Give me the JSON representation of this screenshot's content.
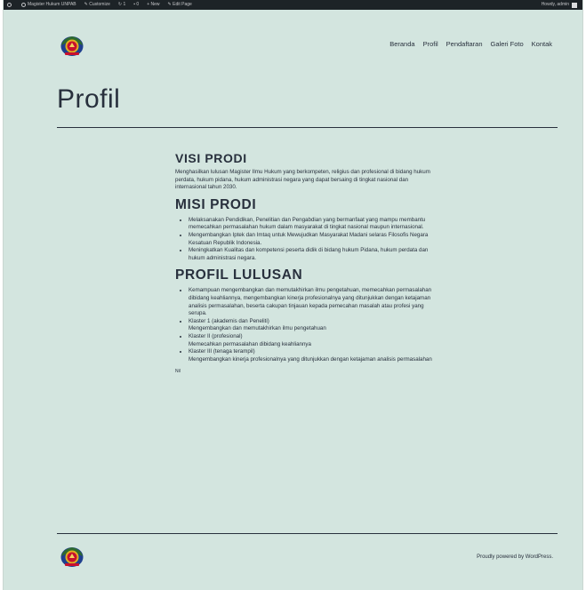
{
  "admin_bar": {
    "items": [
      "Magister Hukum UNPAB",
      "Customize",
      "1",
      "0",
      "New",
      "Edit Page"
    ],
    "user": "Howdy, admin"
  },
  "nav": {
    "items": [
      "Beranda",
      "Profil",
      "Pendaftaran",
      "Galeri Foto",
      "Kontak"
    ]
  },
  "page": {
    "title": "Profil"
  },
  "content": {
    "visi_heading": "VISI PRODI",
    "visi_text": "Menghasilkan lulusan Magister Ilmu Hukum yang berkompeten, religius dan profesional di bidang hukum perdata, hukum pidana, hukum administrasi negara yang dapat bersaing di tingkat nasional dan internasional tahun 2030.",
    "misi_heading": "MISI PRODI",
    "misi_items": [
      "Melaksanakan Pendidikan, Penelitian dan Pengabdian yang bermanfaat yang mampu membantu memecahkan permasalahan hukum dalam masyarakat di tingkat nasional maupun internasional.",
      "Mengembangkan Iptek dan Imtaq untuk Mewujudkan Masyarakat Madani selaras Filosofis Negara Kesatuan Republik Indonesia.",
      "Meningkatkan Kualitas dan kompetensi peserta didik di bidang hukum Pidana, hukum perdata dan hukum administrasi negara."
    ],
    "profil_heading": "PROFIL LULUSAN",
    "profil_items": [
      {
        "title": "Kemampuan mengembangkan dan memutakhirkan ilmu pengetahuan, memecahkan permasalahan dibidang keahliannya, mengembangkan kinerja profesionalnya yang ditunjukkan dengan ketajaman analisis permasalahan, beserta cakupan tinjauan kepada pemecahan masalah atau profesi yang serupa.",
        "desc": ""
      },
      {
        "title": "Klaster 1 (akademis dan Peneliti)",
        "desc": "Mengembangkan dan memutakhirkan ilmu pengetahuan"
      },
      {
        "title": "Klaster II (profesional)",
        "desc": "Memecahkan permasalahan dibidang keahliannya"
      },
      {
        "title": "Klaster III (tenaga terampil)",
        "desc": "Mengembangkan kinerja profesionalnya yang ditunjukkan dengan ketajaman analisis permasalahan"
      }
    ],
    "nil": "Nil"
  },
  "footer": {
    "credit": "Proudly powered by WordPress."
  },
  "colors": {
    "background": "#d3e5df",
    "admin_bar": "#1d2327",
    "text": "#28303d"
  }
}
